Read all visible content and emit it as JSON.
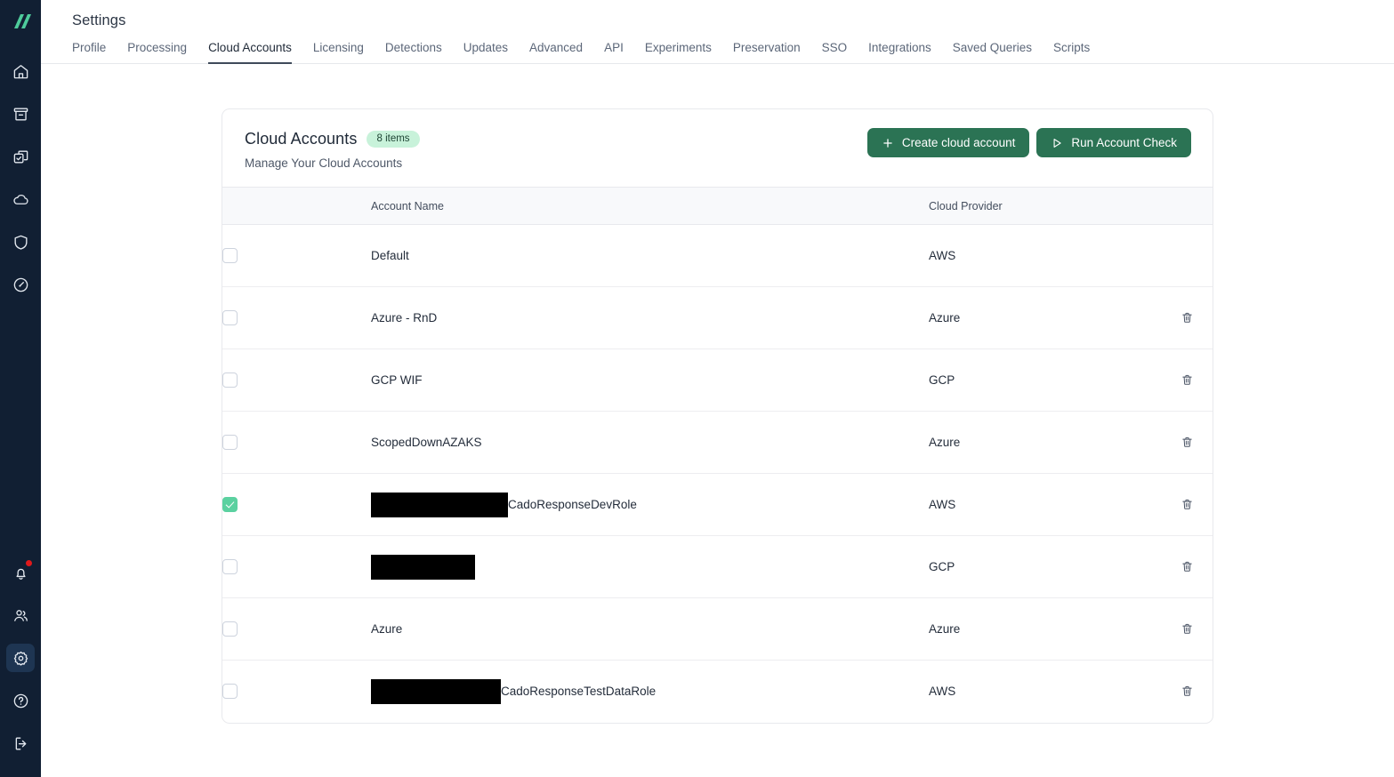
{
  "brand": {
    "logo_icon": "double-slash-logo",
    "logo_color": "#4ecb9b"
  },
  "sidebar": {
    "top_items": [
      {
        "icon": "home-icon",
        "name": "home"
      },
      {
        "icon": "archive-icon",
        "name": "archive"
      },
      {
        "icon": "tasks-icon",
        "name": "tasks"
      },
      {
        "icon": "cloud-icon",
        "name": "cloud"
      },
      {
        "icon": "shield-icon",
        "name": "security"
      },
      {
        "icon": "gauge-icon",
        "name": "performance"
      }
    ],
    "bottom_items": [
      {
        "icon": "bell-icon",
        "name": "notifications",
        "badge": true
      },
      {
        "icon": "users-icon",
        "name": "users",
        "badge": false
      },
      {
        "icon": "gear-icon",
        "name": "settings",
        "badge": false,
        "active": true
      },
      {
        "icon": "help-icon",
        "name": "help",
        "badge": false
      },
      {
        "icon": "logout-icon",
        "name": "logout",
        "badge": false
      }
    ],
    "active_accent_color": "#4ecb9b",
    "notification_dot_color": "#e0191b"
  },
  "header": {
    "title": "Settings",
    "tabs": [
      {
        "label": "Profile",
        "active": false
      },
      {
        "label": "Processing",
        "active": false
      },
      {
        "label": "Cloud Accounts",
        "active": true
      },
      {
        "label": "Licensing",
        "active": false
      },
      {
        "label": "Detections",
        "active": false
      },
      {
        "label": "Updates",
        "active": false
      },
      {
        "label": "Advanced",
        "active": false
      },
      {
        "label": "API",
        "active": false
      },
      {
        "label": "Experiments",
        "active": false
      },
      {
        "label": "Preservation",
        "active": false
      },
      {
        "label": "SSO",
        "active": false
      },
      {
        "label": "Integrations",
        "active": false
      },
      {
        "label": "Saved Queries",
        "active": false
      },
      {
        "label": "Scripts",
        "active": false
      }
    ]
  },
  "card": {
    "title": "Cloud Accounts",
    "badge": "8 items",
    "badge_bg": "#c8f2da",
    "subtitle": "Manage Your Cloud Accounts",
    "actions": [
      {
        "label": "Create cloud account",
        "icon": "plus-icon",
        "name": "create-cloud-account-button"
      },
      {
        "label": "Run Account Check",
        "icon": "play-icon",
        "name": "run-account-check-button"
      }
    ],
    "button_color": "#2b7354"
  },
  "table": {
    "columns": [
      "",
      "Account Name",
      "Cloud Provider",
      ""
    ],
    "rows": [
      {
        "checked": false,
        "redacted_width": 0,
        "name": "Default",
        "provider": "AWS",
        "deletable": false
      },
      {
        "checked": false,
        "redacted_width": 0,
        "name": "Azure - RnD",
        "provider": "Azure",
        "deletable": true
      },
      {
        "checked": false,
        "redacted_width": 0,
        "name": "GCP WIF",
        "provider": "GCP",
        "deletable": true
      },
      {
        "checked": false,
        "redacted_width": 0,
        "name": "ScopedDownAZAKS",
        "provider": "Azure",
        "deletable": true
      },
      {
        "checked": true,
        "redacted_width": 154,
        "name": "CadoResponseDevRole",
        "provider": "AWS",
        "deletable": true
      },
      {
        "checked": false,
        "redacted_width": 117,
        "name": "",
        "provider": "GCP",
        "deletable": true
      },
      {
        "checked": false,
        "redacted_width": 0,
        "name": "Azure",
        "provider": "Azure",
        "deletable": true
      },
      {
        "checked": false,
        "redacted_width": 146,
        "name": "CadoResponseTestDataRole",
        "provider": "AWS",
        "deletable": true
      }
    ],
    "delete_icon": "trash-icon",
    "checked_color": "#5bd1a0"
  }
}
